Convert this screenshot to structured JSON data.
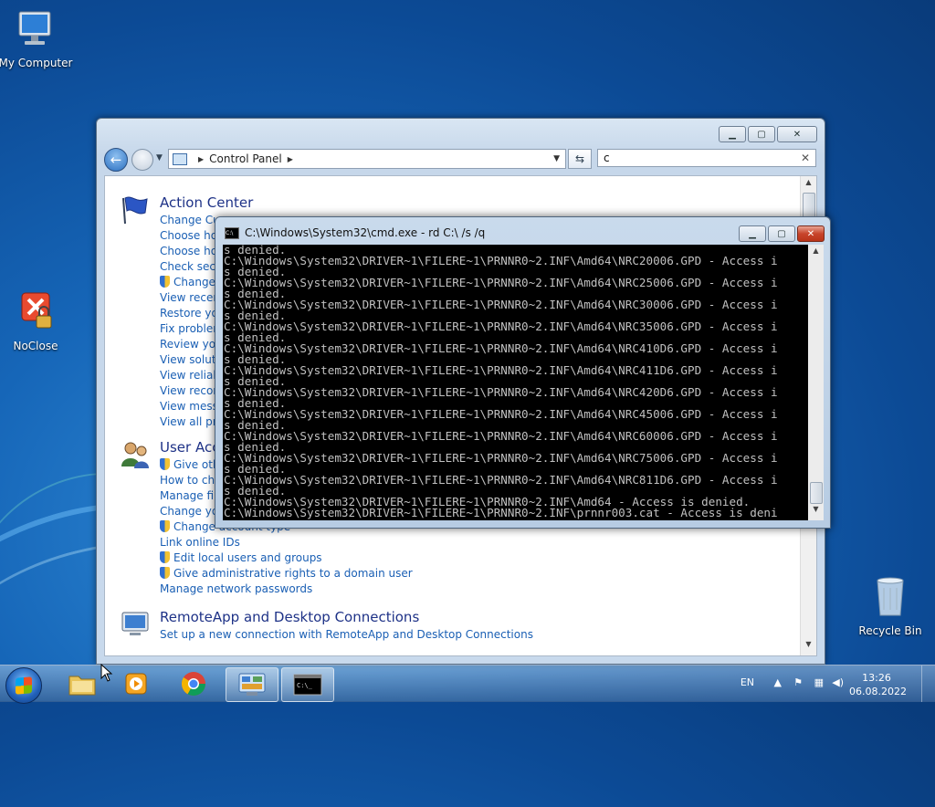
{
  "desktop": {
    "icons": [
      {
        "label": "My Computer"
      },
      {
        "label": "NoClose"
      },
      {
        "label": "Recycle Bin"
      }
    ]
  },
  "control_panel": {
    "address": "Control Panel",
    "search_value": "c",
    "sections": [
      {
        "title": "Action Center",
        "links": [
          {
            "text": "Change Cu",
            "shield": false
          },
          {
            "text": "Choose ho",
            "shield": false
          },
          {
            "text": "Choose ho",
            "shield": false
          },
          {
            "text": "Check secu",
            "shield": false
          },
          {
            "text": "Change",
            "shield": true
          },
          {
            "text": "View recent",
            "shield": false
          },
          {
            "text": "Restore you",
            "shield": false
          },
          {
            "text": "Fix problem",
            "shield": false
          },
          {
            "text": "Review you",
            "shield": false
          },
          {
            "text": "View solutio",
            "shield": false
          },
          {
            "text": "View reliabi",
            "shield": false
          },
          {
            "text": "View recom",
            "shield": false
          },
          {
            "text": "View messa",
            "shield": false
          },
          {
            "text": "View all pro",
            "shield": false
          }
        ]
      },
      {
        "title": "User Acc",
        "links": [
          {
            "text": "Give oth",
            "shield": true
          },
          {
            "text": "How to cha",
            "shield": false
          },
          {
            "text": "Manage file",
            "shield": false
          },
          {
            "text": "Change you",
            "shield": false
          },
          {
            "text": "Change account type",
            "shield": true
          },
          {
            "text": "Link online IDs",
            "shield": false
          },
          {
            "text": "Edit local users and groups",
            "shield": true
          },
          {
            "text": "Give administrative rights to a domain user",
            "shield": true
          },
          {
            "text": "Manage network passwords",
            "shield": false
          }
        ]
      },
      {
        "title": "RemoteApp and Desktop Connections",
        "links": [
          {
            "text": "Set up a new connection with RemoteApp and Desktop Connections",
            "shield": false
          }
        ]
      }
    ]
  },
  "cmd": {
    "title": "C:\\Windows\\System32\\cmd.exe - rd  C:\\ /s /q",
    "lines": [
      "s denied.",
      "C:\\Windows\\System32\\DRIVER~1\\FILERE~1\\PRNNR0~2.INF\\Amd64\\NRC20006.GPD - Access i",
      "s denied.",
      "C:\\Windows\\System32\\DRIVER~1\\FILERE~1\\PRNNR0~2.INF\\Amd64\\NRC25006.GPD - Access i",
      "s denied.",
      "C:\\Windows\\System32\\DRIVER~1\\FILERE~1\\PRNNR0~2.INF\\Amd64\\NRC30006.GPD - Access i",
      "s denied.",
      "C:\\Windows\\System32\\DRIVER~1\\FILERE~1\\PRNNR0~2.INF\\Amd64\\NRC35006.GPD - Access i",
      "s denied.",
      "C:\\Windows\\System32\\DRIVER~1\\FILERE~1\\PRNNR0~2.INF\\Amd64\\NRC410D6.GPD - Access i",
      "s denied.",
      "C:\\Windows\\System32\\DRIVER~1\\FILERE~1\\PRNNR0~2.INF\\Amd64\\NRC411D6.GPD - Access i",
      "s denied.",
      "C:\\Windows\\System32\\DRIVER~1\\FILERE~1\\PRNNR0~2.INF\\Amd64\\NRC420D6.GPD - Access i",
      "s denied.",
      "C:\\Windows\\System32\\DRIVER~1\\FILERE~1\\PRNNR0~2.INF\\Amd64\\NRC45006.GPD - Access i",
      "s denied.",
      "C:\\Windows\\System32\\DRIVER~1\\FILERE~1\\PRNNR0~2.INF\\Amd64\\NRC60006.GPD - Access i",
      "s denied.",
      "C:\\Windows\\System32\\DRIVER~1\\FILERE~1\\PRNNR0~2.INF\\Amd64\\NRC75006.GPD - Access i",
      "s denied.",
      "C:\\Windows\\System32\\DRIVER~1\\FILERE~1\\PRNNR0~2.INF\\Amd64\\NRC811D6.GPD - Access i",
      "s denied.",
      "C:\\Windows\\System32\\DRIVER~1\\FILERE~1\\PRNNR0~2.INF\\Amd64 - Access is denied.",
      "C:\\Windows\\System32\\DRIVER~1\\FILERE~1\\PRNNR0~2.INF\\prnnr003.cat - Access is deni"
    ]
  },
  "taskbar": {
    "items": [
      {
        "icon": "windows-explorer-icon"
      },
      {
        "icon": "media-player-icon"
      },
      {
        "icon": "chrome-icon"
      },
      {
        "icon": "control-panel-icon"
      },
      {
        "icon": "cmd-icon"
      }
    ],
    "language": "EN",
    "time": "13:26",
    "date": "06.08.2022"
  }
}
